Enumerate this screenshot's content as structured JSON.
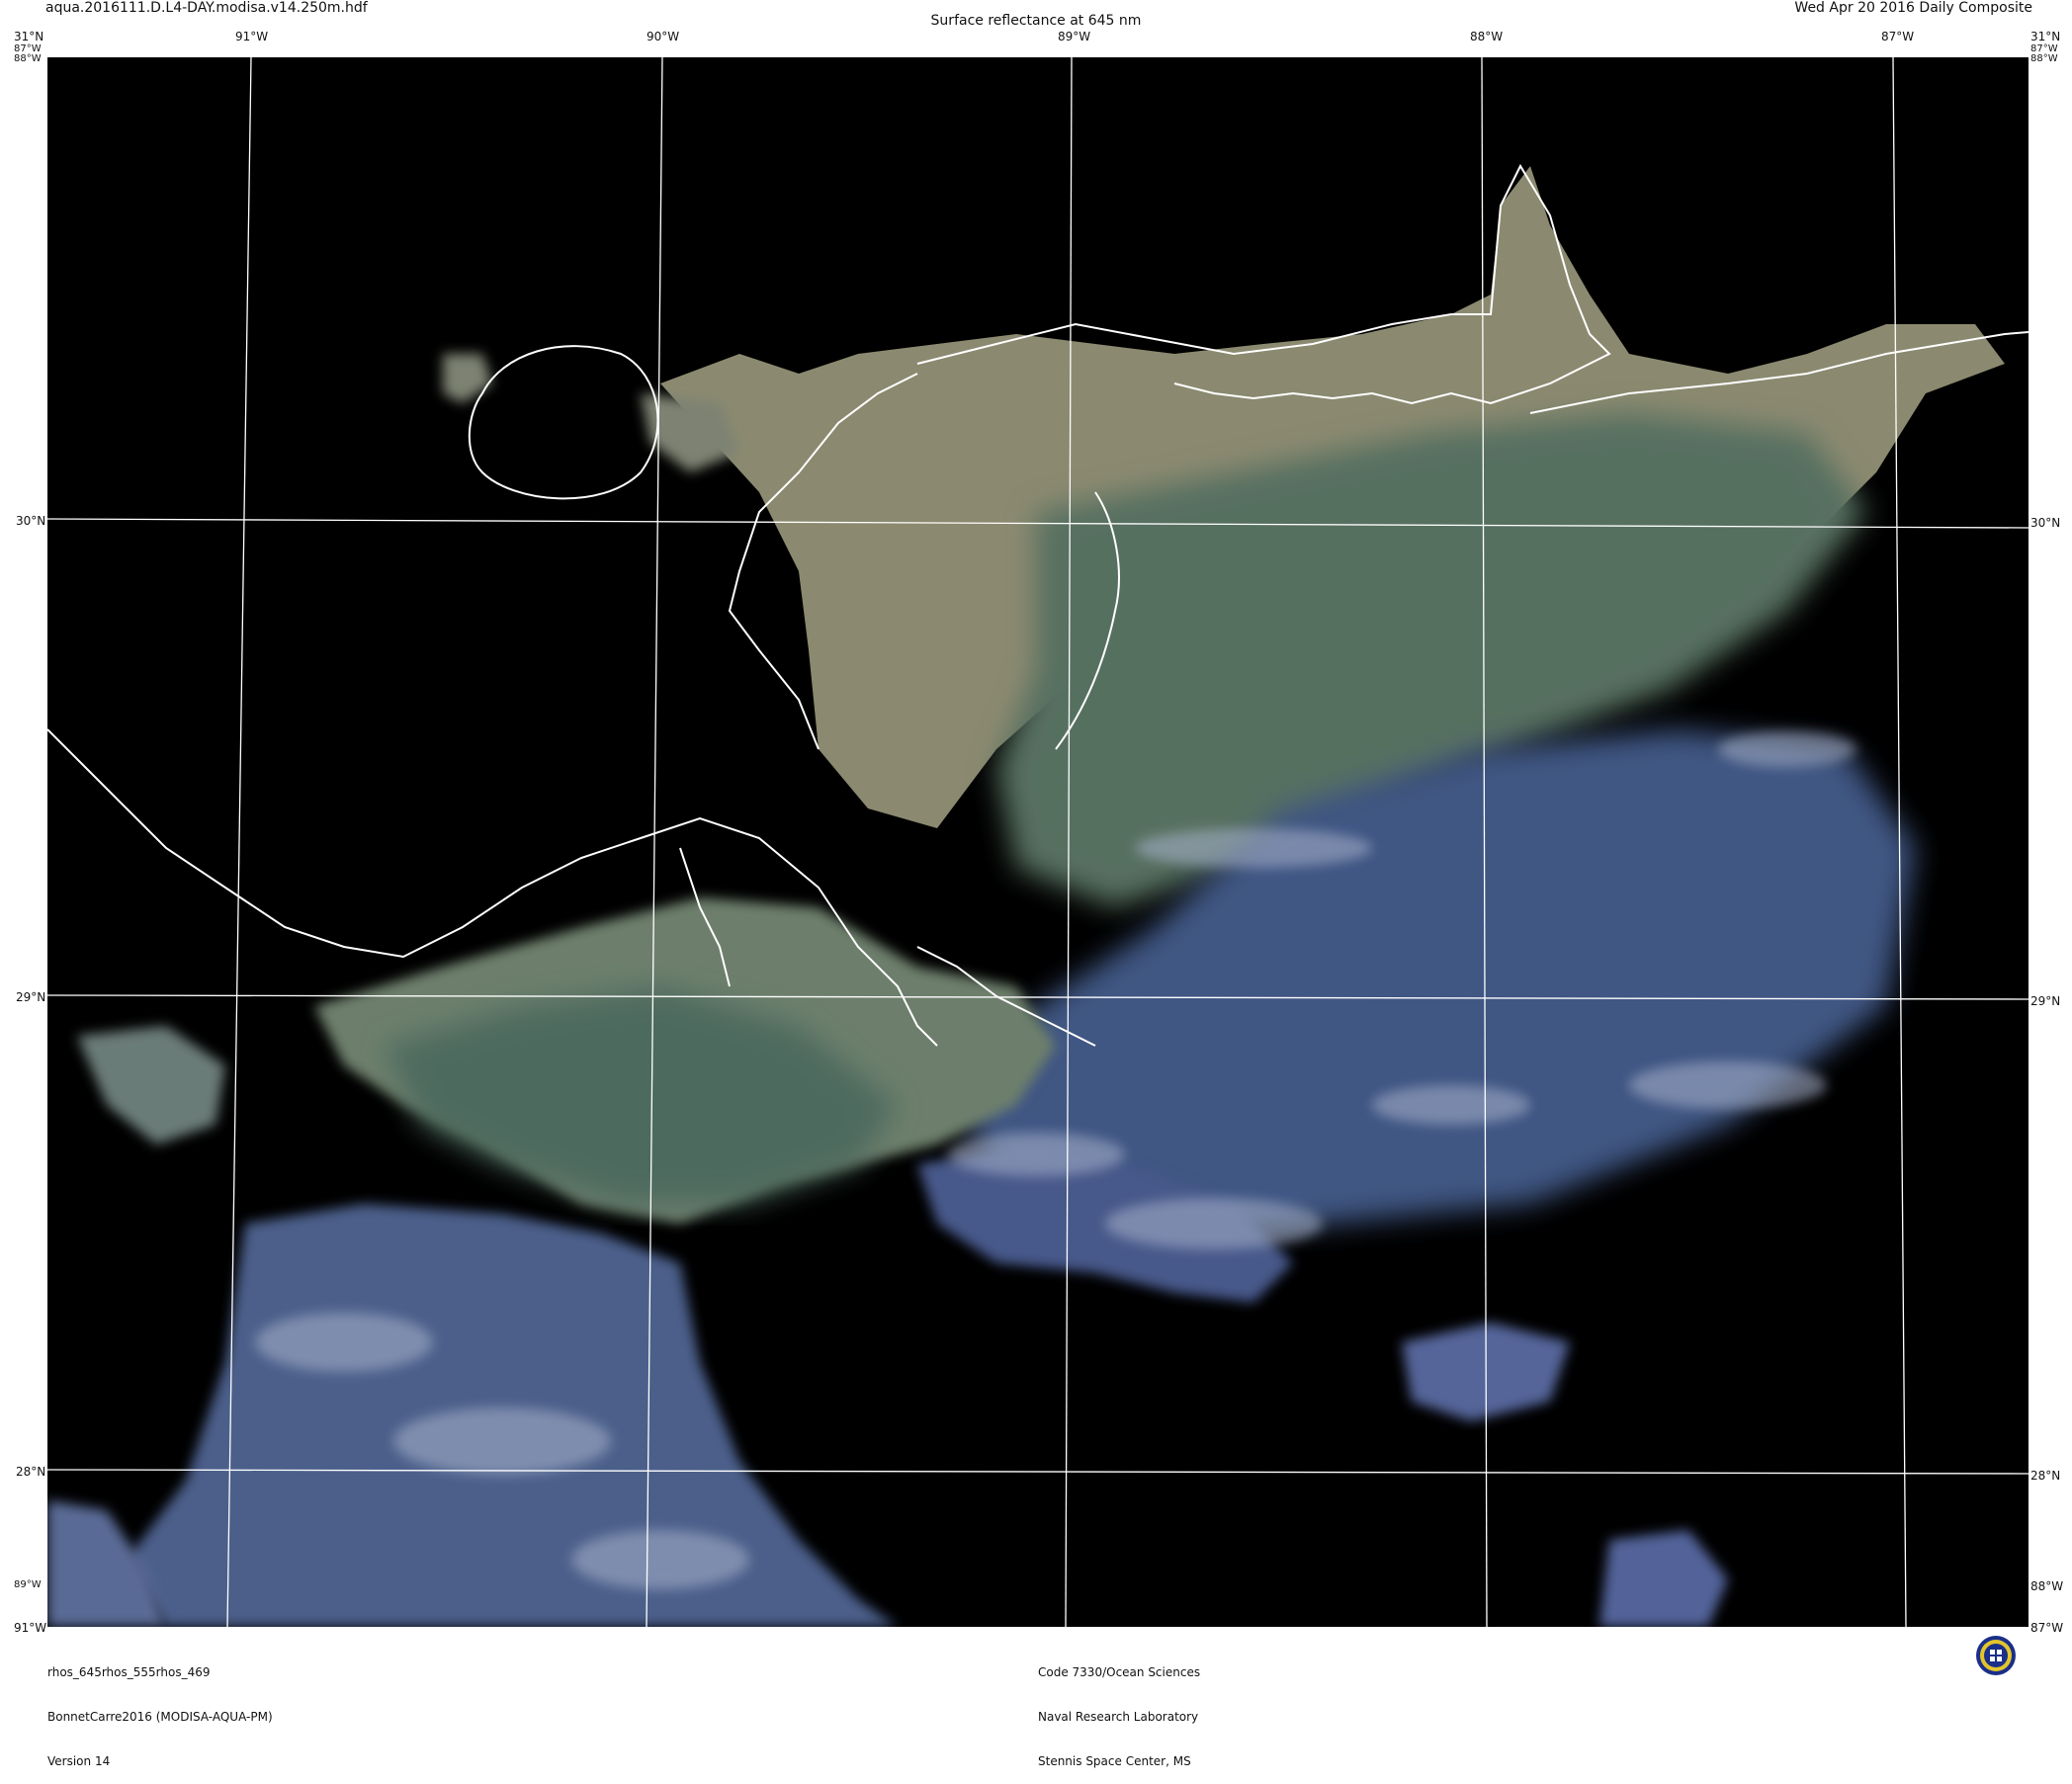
{
  "header": {
    "file_name": "aqua.2016111.D.L4-DAY.modisa.v14.250m.hdf",
    "title": "Surface reflectance at 645 nm",
    "date": "Wed Apr 20 2016 Daily Composite"
  },
  "map": {
    "top_lon_labels": [
      "91°W",
      "90°W",
      "89°W",
      "88°W",
      "87°W"
    ],
    "lat_labels": [
      "30°N",
      "29°N",
      "28°N"
    ],
    "corner_labels": {
      "top_left_lat": "31°N",
      "top_left_lon": "87°W",
      "top_left_lon2": "88°W",
      "top_right_lat": "31°N",
      "top_right_lon": "87°W",
      "top_right_lon2": "88°W",
      "bottom_left_lon": "89°W",
      "bottom_left_lon2": "91°W",
      "bottom_right_lon": "88°W",
      "bottom_right_lon2": "87°W"
    },
    "colors": {
      "background": "#000000",
      "turbid_water": "#8a8a72",
      "green_water": "#4f6e5c",
      "blue_water": "#3e5480",
      "cloud": "#8e9cb8",
      "coastline": "#ffffff",
      "grid": "#ffffff"
    }
  },
  "footer": {
    "left": [
      "rhos_645rhos_555rhos_469",
      "BonnetCarre2016 (MODISA-AQUA-PM)",
      "Version 14"
    ],
    "center": [
      "Code 7330/Ocean Sciences",
      "Naval Research Laboratory",
      "Stennis Space Center, MS"
    ],
    "logo_icon": "nrl-seal-icon"
  }
}
